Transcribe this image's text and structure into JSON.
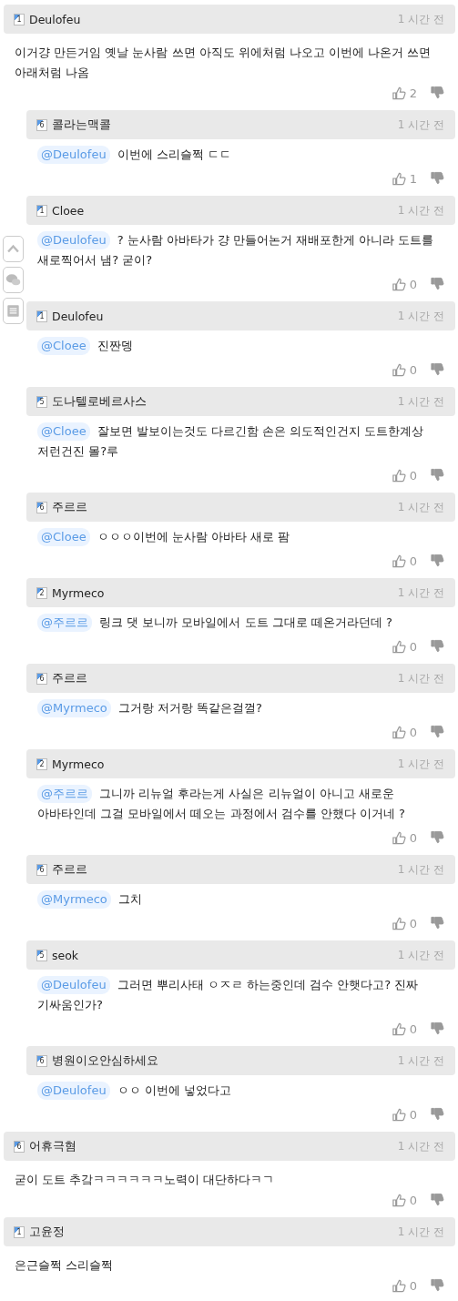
{
  "comments": [
    {
      "author": "Deulofeu",
      "level": "1",
      "time": "1 시간 전",
      "text": "이거걍 만든거임 옛날 눈사람 쓰면 아직도 위에처럼 나오고 이번에 나온거 쓰면 아래처럼 나옴",
      "likes": "2",
      "replies": [
        {
          "author": "콜라는맥콜",
          "level": "6",
          "time": "1 시간 전",
          "mention": "@Deulofeu",
          "text": "이번에 스리슬쩍 ㄷㄷ",
          "likes": "1"
        },
        {
          "author": "Cloee",
          "level": "1",
          "time": "1 시간 전",
          "mention": "@Deulofeu",
          "text": "? 눈사람 아바타가 걍 만들어논거 재배포한게 아니라 도트를 새로찍어서 냄? 굳이?",
          "likes": "0"
        },
        {
          "author": "Deulofeu",
          "level": "1",
          "time": "1 시간 전",
          "mention": "@Cloee",
          "text": "진짠뎅",
          "likes": "0"
        },
        {
          "author": "도나텔로베르사스",
          "level": "5",
          "time": "1 시간 전",
          "mention": "@Cloee",
          "text": "잘보면 발보이는것도 다르긴함 손은 의도적인건지 도트한계상 저런건진 몰?루",
          "likes": "0"
        },
        {
          "author": "주르르",
          "level": "6",
          "time": "1 시간 전",
          "mention": "@Cloee",
          "text": "ㅇㅇㅇ이번에 눈사람 아바타 새로 팜",
          "likes": "0"
        },
        {
          "author": "Myrmeco",
          "level": "2",
          "time": "1 시간 전",
          "mention": "@주르르",
          "text": "링크 댓 보니까 모바일에서 도트 그대로 떼온거라던데 ?",
          "likes": "0"
        },
        {
          "author": "주르르",
          "level": "6",
          "time": "1 시간 전",
          "mention": "@Myrmeco",
          "text": "그거랑 저거랑 똑같은걸껄?",
          "likes": "0"
        },
        {
          "author": "Myrmeco",
          "level": "2",
          "time": "1 시간 전",
          "mention": "@주르르",
          "text": "그니까 리뉴얼 후라는게 사실은 리뉴얼이 아니고 새로운 아바타인데 그걸 모바일에서 떼오는 과정에서 검수를 안했다 이거네 ?",
          "likes": "0"
        },
        {
          "author": "주르르",
          "level": "6",
          "time": "1 시간 전",
          "mention": "@Myrmeco",
          "text": "그치",
          "likes": "0"
        },
        {
          "author": "seok",
          "level": "5",
          "time": "1 시간 전",
          "mention": "@Deulofeu",
          "text": "그러면 뿌리사태 ㅇㅈㄹ 하는중인데 검수 안햇다고? 진짜 기싸움인가?",
          "likes": "0"
        },
        {
          "author": "병원이오안심하세요",
          "level": "6",
          "time": "1 시간 전",
          "mention": "@Deulofeu",
          "text": "ㅇㅇ 이번에 넣었다고",
          "likes": "0"
        }
      ]
    },
    {
      "author": "어휴극혐",
      "level": "6",
      "time": "1 시간 전",
      "text": "굳이 도트 추갘ㅋㅋㅋㅋㅋㅋ노력이 대단하다ㅋㄱ",
      "likes": "0"
    },
    {
      "author": "고윤정",
      "level": "1",
      "time": "1 시간 전",
      "text": "은근슬쩍 스리슬쩍",
      "likes": "0"
    }
  ]
}
